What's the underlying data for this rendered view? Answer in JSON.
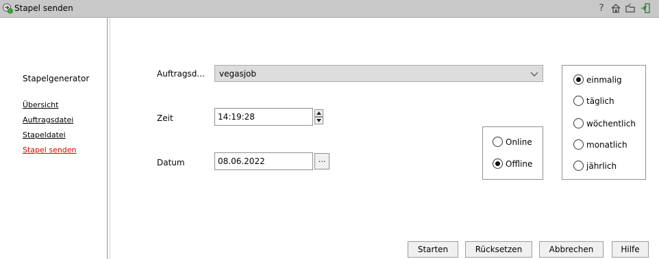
{
  "window": {
    "title": "Stapel senden"
  },
  "titlebar_icons": {
    "help": "?"
  },
  "sidebar": {
    "heading": "Stapelgenerator",
    "links": [
      {
        "label": "Übersicht",
        "active": false
      },
      {
        "label": "Auftragsdatei",
        "active": false
      },
      {
        "label": "Stapeldatei",
        "active": false
      },
      {
        "label": "Stapel senden",
        "active": true
      }
    ]
  },
  "form": {
    "auftrag_label": "Auftragsd...",
    "auftrag_value": "vegasjob",
    "zeit_label": "Zeit",
    "zeit_value": "14:19:28",
    "datum_label": "Datum",
    "datum_value": "08.06.2022",
    "datum_button": "..."
  },
  "mode_group": {
    "options": [
      {
        "label": "Online",
        "checked": false
      },
      {
        "label": "Offline",
        "checked": true
      }
    ]
  },
  "frequency_group": {
    "options": [
      {
        "label": "einmalig",
        "checked": true
      },
      {
        "label": "täglich",
        "checked": false
      },
      {
        "label": "wöchentlich",
        "checked": false
      },
      {
        "label": "monatlich",
        "checked": false
      },
      {
        "label": "jährlich",
        "checked": false
      }
    ]
  },
  "buttons": {
    "start": "Starten",
    "reset": "Rücksetzen",
    "cancel": "Abbrechen",
    "help": "Hilfe"
  },
  "colors": {
    "active_link": "#e00000",
    "titlebar": "#c8c8c8"
  }
}
